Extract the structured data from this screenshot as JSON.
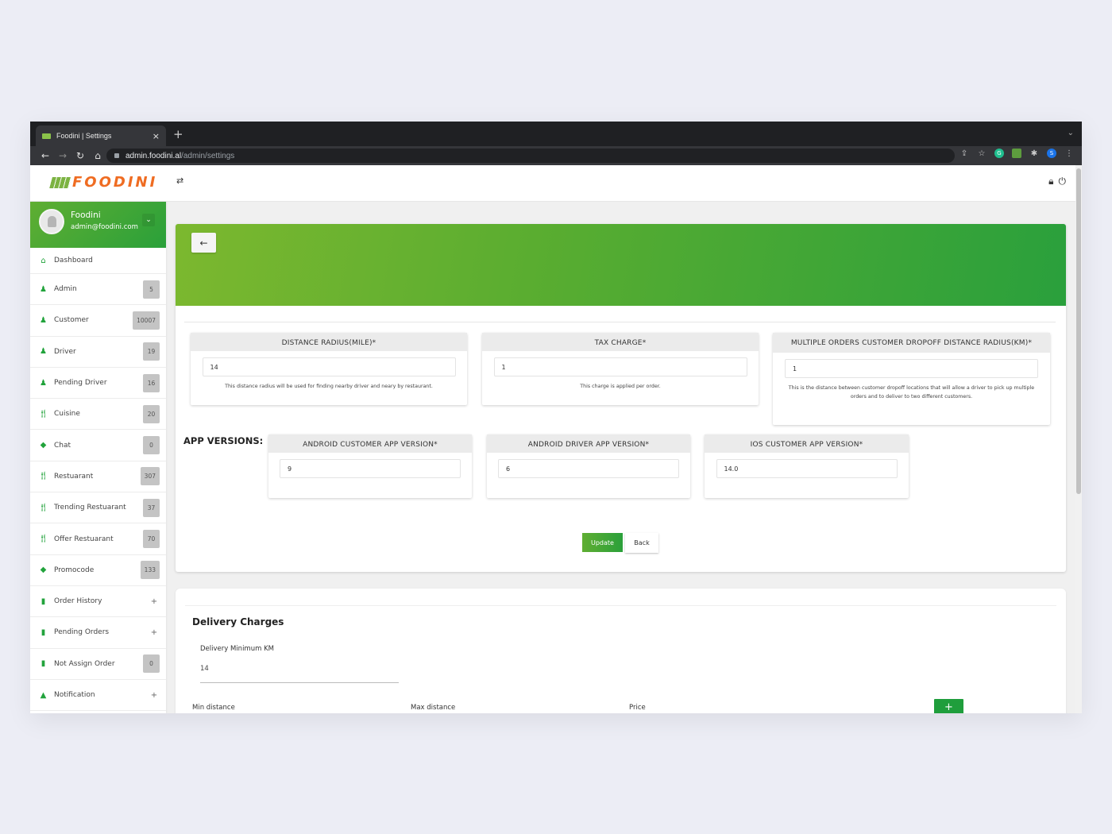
{
  "browser": {
    "tab_title": "Foodini | Settings",
    "url_host": "admin.foodini.al",
    "url_path": "/admin/settings",
    "profile_initial": "S"
  },
  "header": {
    "logo_text": "FOODINI"
  },
  "profile": {
    "name": "Foodini",
    "email": "admin@foodini.com"
  },
  "sidebar": {
    "items": [
      {
        "label": "Dashboard",
        "icon": "home-icon",
        "badge": null,
        "plus": false
      },
      {
        "label": "Admin",
        "icon": "user-icon",
        "badge": "5",
        "plus": false
      },
      {
        "label": "Customer",
        "icon": "user-icon",
        "badge": "10007",
        "plus": false
      },
      {
        "label": "Driver",
        "icon": "user-icon",
        "badge": "19",
        "plus": false
      },
      {
        "label": "Pending Driver",
        "icon": "user-icon",
        "badge": "16",
        "plus": false
      },
      {
        "label": "Cuisine",
        "icon": "cutlery-icon",
        "badge": "20",
        "plus": false
      },
      {
        "label": "Chat",
        "icon": "tag-icon",
        "badge": "0",
        "plus": false
      },
      {
        "label": "Restuarant",
        "icon": "cutlery-icon",
        "badge": "307",
        "plus": false
      },
      {
        "label": "Trending Restuarant",
        "icon": "cutlery-icon",
        "badge": "37",
        "plus": false
      },
      {
        "label": "Offer Restuarant",
        "icon": "cutlery-icon",
        "badge": "70",
        "plus": false
      },
      {
        "label": "Promocode",
        "icon": "tag-icon",
        "badge": "133",
        "plus": false
      },
      {
        "label": "Order History",
        "icon": "file-icon",
        "badge": null,
        "plus": true
      },
      {
        "label": "Pending Orders",
        "icon": "file-icon",
        "badge": null,
        "plus": true
      },
      {
        "label": "Not Assign Order",
        "icon": "file-icon",
        "badge": "0",
        "plus": false
      },
      {
        "label": "Notification",
        "icon": "bell-icon",
        "badge": null,
        "plus": true
      }
    ],
    "plus_symbol": "+"
  },
  "settings": {
    "distance_radius": {
      "label": "DISTANCE RADIUS(MILE)*",
      "value": "14",
      "hint": "This distance radius will be used for finding nearby driver and neary by restaurant."
    },
    "tax_charge": {
      "label": "TAX CHARGE*",
      "value": "1",
      "hint": "This charge is applied per order."
    },
    "multi_dropoff": {
      "label": "MULTIPLE ORDERS CUSTOMER DROPOFF DISTANCE RADIUS(KM)*",
      "value": "1",
      "hint": "This is the distance between customer dropoff locations that will allow a driver to pick up multiple orders and to deliver to two different customers."
    },
    "app_versions_label": "APP VERSIONS:",
    "android_customer": {
      "label": "ANDROID CUSTOMER APP VERSION*",
      "value": "9"
    },
    "android_driver": {
      "label": "ANDROID DRIVER APP VERSION*",
      "value": "6"
    },
    "ios_customer": {
      "label": "IOS CUSTOMER APP VERSION*",
      "value": "14.0"
    },
    "update_label": "Update",
    "back_label": "Back"
  },
  "delivery": {
    "title": "Delivery Charges",
    "min_km_label": "Delivery Minimum KM",
    "min_km_value": "14",
    "columns": [
      "Min distance",
      "Max distance",
      "Price"
    ],
    "add_symbol": "+"
  },
  "colors": {
    "brand_green": "#2aa03a",
    "banner_light": "#7cb82f",
    "logo_orange": "#ef6c22",
    "badge_gray": "#c4c4c4"
  }
}
